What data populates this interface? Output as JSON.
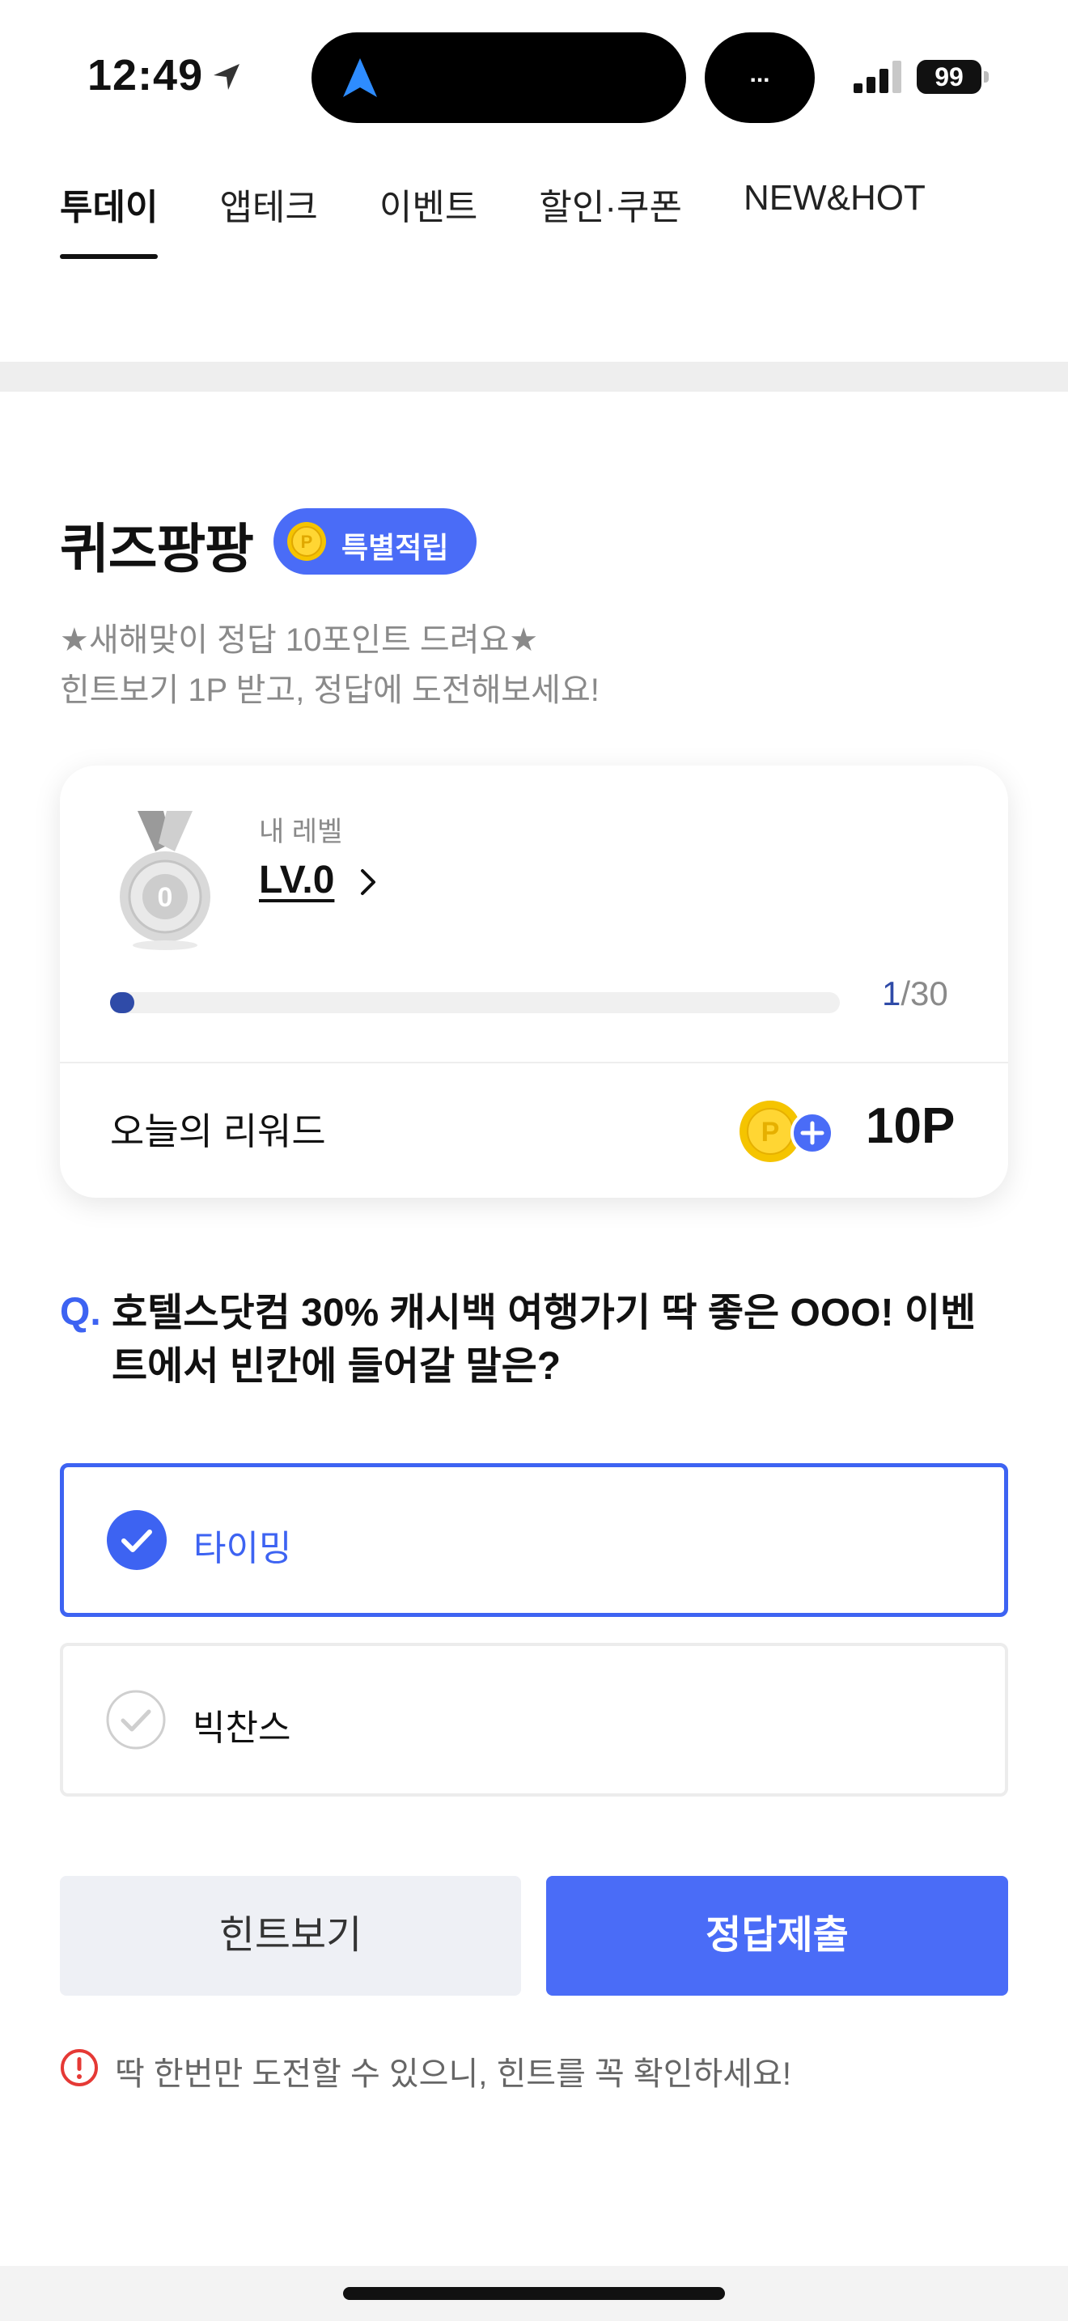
{
  "status_bar": {
    "time": "12:49",
    "island_dots": "...",
    "battery": "99"
  },
  "tabs": [
    {
      "label": "투데이",
      "active": true
    },
    {
      "label": "앱테크",
      "active": false
    },
    {
      "label": "이벤트",
      "active": false
    },
    {
      "label": "할인·쿠폰",
      "active": false
    },
    {
      "label": "NEW&HOT",
      "active": false
    }
  ],
  "quiz": {
    "title": "퀴즈팡팡",
    "badge": "특별적립",
    "desc_line1": "★새해맞이 정답 10포인트 드려요★",
    "desc_line2": "힌트보기 1P 받고, 정답에 도전해보세요!"
  },
  "level_card": {
    "medal_number": "0",
    "label": "내 레벨",
    "value": "LV.0",
    "progress_current": "1",
    "progress_total": "/30",
    "progress_fraction": 0.033,
    "reward_label": "오늘의 리워드",
    "reward_value": "10P"
  },
  "question": {
    "mark": "Q.",
    "text": "호텔스닷컴 30% 캐시백 여행가기 딱 좋은 OOO! 이벤트에서 빈칸에 들어갈 말은?"
  },
  "options": [
    {
      "label": "타이밍",
      "selected": true
    },
    {
      "label": "빅찬스",
      "selected": false
    }
  ],
  "buttons": {
    "hint": "힌트보기",
    "submit": "정답제출"
  },
  "warning": "딱 한번만 도전할 수 있으니, 힌트를 꼭 확인하세요!",
  "colors": {
    "accent": "#4a6cf7",
    "progress": "#2f4ba8",
    "coin": "#f5c400"
  }
}
